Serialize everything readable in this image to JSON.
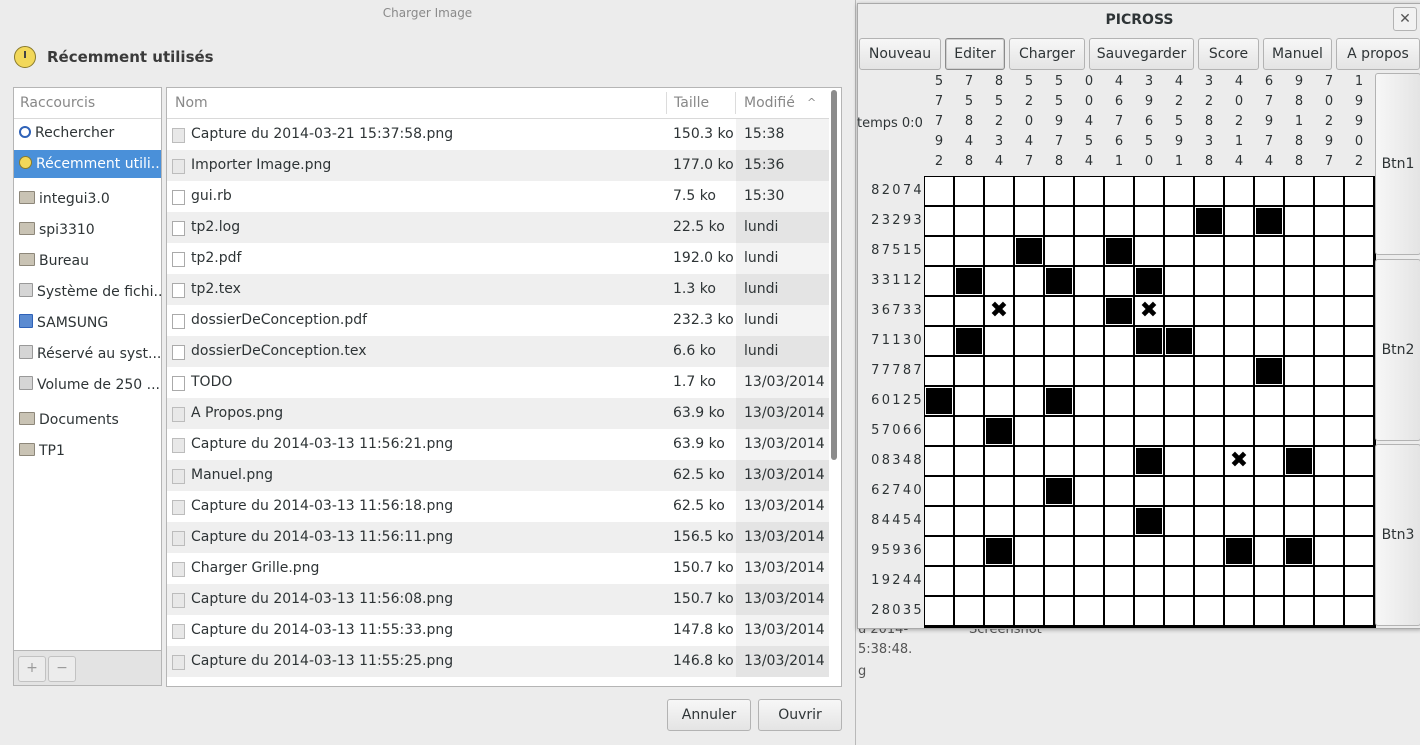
{
  "dialog": {
    "title": "Charger Image",
    "location": "Récemment utilisés",
    "places_header": "Raccourcis",
    "places": [
      {
        "label": "Rechercher",
        "icon": "search-icon",
        "selected": false
      },
      {
        "label": "Récemment utili...",
        "icon": "recent-icon",
        "selected": true
      },
      {
        "label": "integui3.0",
        "icon": "folder-icon",
        "selected": false
      },
      {
        "label": "spi3310",
        "icon": "home-folder-icon",
        "selected": false
      },
      {
        "label": "Bureau",
        "icon": "folder-icon",
        "selected": false
      },
      {
        "label": "Système de fichi...",
        "icon": "drive-icon",
        "selected": false
      },
      {
        "label": "SAMSUNG",
        "icon": "usb-drive-icon",
        "selected": false
      },
      {
        "label": "Réservé au syst...",
        "icon": "drive-icon",
        "selected": false
      },
      {
        "label": "Volume de 250 ...",
        "icon": "drive-icon",
        "selected": false
      },
      {
        "label": "Documents",
        "icon": "folder-icon",
        "selected": false
      },
      {
        "label": "TP1",
        "icon": "folder-icon",
        "selected": false
      }
    ],
    "add_label": "+",
    "remove_label": "−",
    "columns": {
      "name": "Nom",
      "size": "Taille",
      "modified": "Modifié",
      "sort_indicator": "^"
    },
    "files": [
      {
        "name": "Capture du 2014-03-21 15:37:58.png",
        "size": "150.3 ko",
        "modified": "15:38"
      },
      {
        "name": "Importer Image.png",
        "size": "177.0 ko",
        "modified": "15:36"
      },
      {
        "name": "gui.rb",
        "size": "7.5 ko",
        "modified": "15:30"
      },
      {
        "name": "tp2.log",
        "size": "22.5 ko",
        "modified": "lundi"
      },
      {
        "name": "tp2.pdf",
        "size": "192.0 ko",
        "modified": "lundi"
      },
      {
        "name": "tp2.tex",
        "size": "1.3 ko",
        "modified": "lundi"
      },
      {
        "name": "dossierDeConception.pdf",
        "size": "232.3 ko",
        "modified": "lundi"
      },
      {
        "name": "dossierDeConception.tex",
        "size": "6.6 ko",
        "modified": "lundi"
      },
      {
        "name": "TODO",
        "size": "1.7 ko",
        "modified": "13/03/2014"
      },
      {
        "name": "A Propos.png",
        "size": "63.9 ko",
        "modified": "13/03/2014"
      },
      {
        "name": "Capture du 2014-03-13 11:56:21.png",
        "size": "63.9 ko",
        "modified": "13/03/2014"
      },
      {
        "name": "Manuel.png",
        "size": "62.5 ko",
        "modified": "13/03/2014"
      },
      {
        "name": "Capture du 2014-03-13 11:56:18.png",
        "size": "62.5 ko",
        "modified": "13/03/2014"
      },
      {
        "name": "Capture du 2014-03-13 11:56:11.png",
        "size": "156.5 ko",
        "modified": "13/03/2014"
      },
      {
        "name": "Charger Grille.png",
        "size": "150.7 ko",
        "modified": "13/03/2014"
      },
      {
        "name": "Capture du 2014-03-13 11:56:08.png",
        "size": "150.7 ko",
        "modified": "13/03/2014"
      },
      {
        "name": "Capture du 2014-03-13 11:55:33.png",
        "size": "147.8 ko",
        "modified": "13/03/2014"
      },
      {
        "name": "Capture du 2014-03-13 11:55:25.png",
        "size": "146.8 ko",
        "modified": "13/03/2014"
      }
    ],
    "cancel_label": "Annuler",
    "open_label": "Ouvrir"
  },
  "background": {
    "fragment_1": "u 2014-",
    "fragment_2": "5:38:48.",
    "fragment_3": "g",
    "fragment_4": "Screenshot"
  },
  "picross": {
    "title": "PICROSS",
    "close_label": "✕",
    "toolbar": [
      "Nouveau",
      "Editer",
      "Charger",
      "Sauvegarder",
      "Score",
      "Manuel",
      "A propos"
    ],
    "active_tool": "Editer",
    "timer": "temps 0:0",
    "column_clues": [
      "5\n7\n7\n9\n2",
      "7\n5\n8\n4\n8",
      "8\n5\n2\n3\n4",
      "5\n2\n0\n4\n7",
      "5\n5\n9\n7\n8",
      "0\n0\n4\n5\n4",
      "4\n6\n7\n6\n1",
      "3\n9\n6\n5\n0",
      "4\n2\n5\n9\n1",
      "3\n2\n8\n3\n8",
      "4\n0\n2\n1\n4",
      "6\n7\n9\n7\n4",
      "9\n8\n1\n8\n8",
      "7\n0\n2\n9\n7",
      "1\n9\n9\n0\n2"
    ],
    "row_clues": [
      "82074",
      "23293",
      "87515",
      "33112",
      "36733",
      "71130",
      "77787",
      "60125",
      "57066",
      "08348",
      "62740",
      "84454",
      "95936",
      "19244",
      "28035"
    ],
    "filled_cells": [
      [
        1,
        9
      ],
      [
        1,
        11
      ],
      [
        2,
        3
      ],
      [
        2,
        6
      ],
      [
        3,
        1
      ],
      [
        3,
        4
      ],
      [
        3,
        7
      ],
      [
        4,
        6
      ],
      [
        5,
        1
      ],
      [
        5,
        7
      ],
      [
        5,
        8
      ],
      [
        6,
        11
      ],
      [
        7,
        0
      ],
      [
        7,
        4
      ],
      [
        8,
        2
      ],
      [
        9,
        7
      ],
      [
        9,
        12
      ],
      [
        10,
        4
      ],
      [
        11,
        7
      ],
      [
        12,
        2
      ],
      [
        12,
        10
      ],
      [
        12,
        12
      ]
    ],
    "crossed_cells": [
      [
        4,
        2
      ],
      [
        4,
        7
      ],
      [
        9,
        10
      ]
    ],
    "cross_symbol": "✖",
    "side_buttons": [
      "Btn1",
      "Btn2",
      "Btn3"
    ]
  }
}
